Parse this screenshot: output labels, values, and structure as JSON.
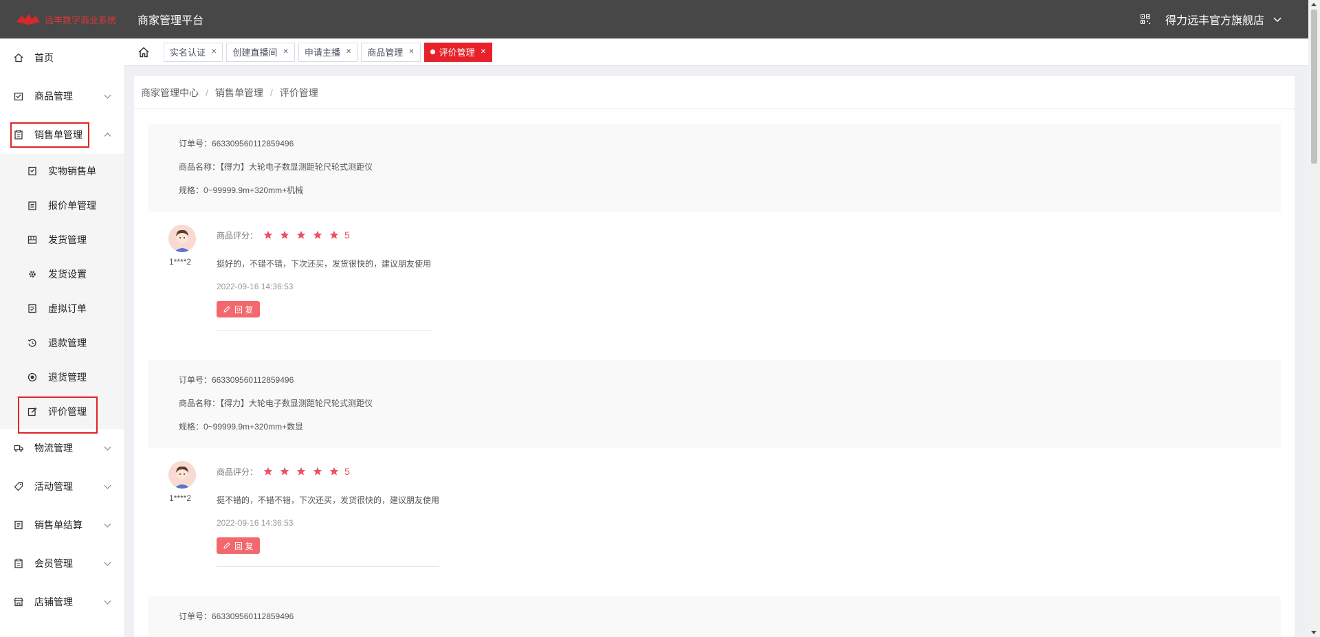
{
  "header": {
    "logo_text": "远丰数字商业系统",
    "platform_title": "商家管理平台",
    "store_name": "得力远丰官方旗舰店"
  },
  "sidebar": {
    "items": [
      {
        "label": "首页",
        "icon": "home-icon"
      },
      {
        "label": "商品管理",
        "icon": "goods-icon"
      },
      {
        "label": "销售单管理",
        "icon": "clipboard-icon",
        "expanded": true,
        "highlighted": true
      },
      {
        "label": "物流管理",
        "icon": "truck-icon"
      },
      {
        "label": "活动管理",
        "icon": "tag-icon"
      },
      {
        "label": "销售单结算",
        "icon": "ledger-icon"
      },
      {
        "label": "会员管理",
        "icon": "member-icon"
      },
      {
        "label": "店铺管理",
        "icon": "store-icon"
      }
    ],
    "sub_items": [
      {
        "label": "实物销售单",
        "icon": "order-icon"
      },
      {
        "label": "报价单管理",
        "icon": "quote-icon"
      },
      {
        "label": "发货管理",
        "icon": "package-icon"
      },
      {
        "label": "发货设置",
        "icon": "gear-icon"
      },
      {
        "label": "虚拟订单",
        "icon": "virtual-order-icon"
      },
      {
        "label": "退款管理",
        "icon": "refund-icon"
      },
      {
        "label": "退货管理",
        "icon": "return-icon"
      },
      {
        "label": "评价管理",
        "icon": "edit-icon",
        "active": true,
        "highlighted": true
      }
    ]
  },
  "tabs": [
    {
      "label": "实名认证"
    },
    {
      "label": "创建直播间"
    },
    {
      "label": "申请主播"
    },
    {
      "label": "商品管理"
    },
    {
      "label": "评价管理",
      "active": true
    }
  ],
  "breadcrumb": [
    "商家管理中心",
    "销售单管理",
    "评价管理"
  ],
  "reviews": [
    {
      "order_no": "订单号：663309560112859496",
      "product": "商品名称：【得力】大轮电子数显测距轮尺轮式测距仪",
      "spec": "规格：0~99999.9m+320mm+机械",
      "user": "1****2",
      "rating_label": "商品评分：",
      "rating": 5,
      "rating_text": "5",
      "content": "挺好的，不错不错，下次还买，发货很快的，建议朋友使用",
      "time": "2022-09-16 14:36:53",
      "reply_label": "回 复"
    },
    {
      "order_no": "订单号：663309560112859496",
      "product": "商品名称：【得力】大轮电子数显测距轮尺轮式测距仪",
      "spec": "规格：0~99999.9m+320mm+数显",
      "user": "1****2",
      "rating_label": "商品评分：",
      "rating": 5,
      "rating_text": "5",
      "content": "挺不错的，不错不错，下次还买，发货很快的，建议朋友使用",
      "time": "2022-09-16 14:36:53",
      "reply_label": "回 复"
    },
    {
      "order_no": "订单号：663309560112859496"
    }
  ],
  "colors": {
    "header_bg": "#474747",
    "accent_red": "#e6212a",
    "star_pink": "#f0505e",
    "reply_btn": "#f2686d",
    "highlight_box": "#e02424"
  }
}
